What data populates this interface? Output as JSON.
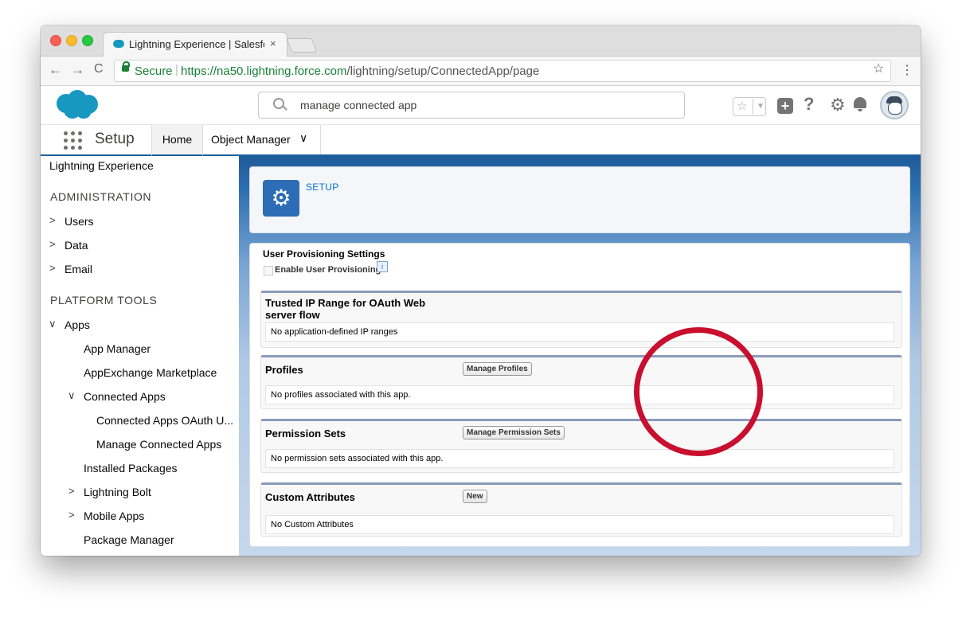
{
  "browser": {
    "tab_title": "Lightning Experience | Salesforce",
    "tab_close": "×",
    "secure_label": "Secure",
    "url_host": "https://na50.lightning.force.com",
    "url_path": "/lightning/setup/ConnectedApp/page",
    "back": "←",
    "forward": "→",
    "reload": "C",
    "star": "☆",
    "menu": "⋮"
  },
  "header": {
    "search_value": "manage connected app",
    "help": "?",
    "gear": "⚙",
    "plus": "+",
    "fav_star": "☆",
    "fav_caret": "▼"
  },
  "context": {
    "app_name": "Setup",
    "home_tab": "Home",
    "object_manager_tab": "Object Manager",
    "chevron": "∨"
  },
  "sidebar": {
    "top_item": "Lightning Experience",
    "admin_heading": "ADMINISTRATION",
    "users": "Users",
    "data": "Data",
    "email": "Email",
    "platform_heading": "PLATFORM TOOLS",
    "apps": "Apps",
    "app_manager": "App Manager",
    "appexchange": "AppExchange Marketplace",
    "connected_apps": "Connected Apps",
    "connected_oauth": "Connected Apps OAuth U...",
    "manage_connected": "Manage Connected Apps",
    "installed_packages": "Installed Packages",
    "lightning_bolt": "Lightning Bolt",
    "mobile_apps": "Mobile Apps",
    "package_manager": "Package Manager",
    "chev_right": ">",
    "chev_down": "∨"
  },
  "main": {
    "setup_label": "SETUP",
    "setup_icon": "⚙",
    "user_provisioning_title": "User Provisioning Settings",
    "enable_user_provisioning": "Enable User Provisioning",
    "info": "i",
    "trusted_ip_title": "Trusted IP Range for OAuth Web server flow",
    "trusted_ip_body": "No application-defined IP ranges",
    "profiles_title": "Profiles",
    "manage_profiles_btn": "Manage Profiles",
    "profiles_body": "No profiles associated with this app.",
    "permsets_title": "Permission Sets",
    "manage_permsets_btn": "Manage Permission Sets",
    "permsets_body": "No permission sets associated with this app.",
    "custom_attr_title": "Custom Attributes",
    "new_btn": "New",
    "custom_attr_body": "No Custom Attributes"
  },
  "colors": {
    "brand_blue": "#1798c1",
    "annotation_red": "#c8102e",
    "link_blue": "#0070d2"
  }
}
